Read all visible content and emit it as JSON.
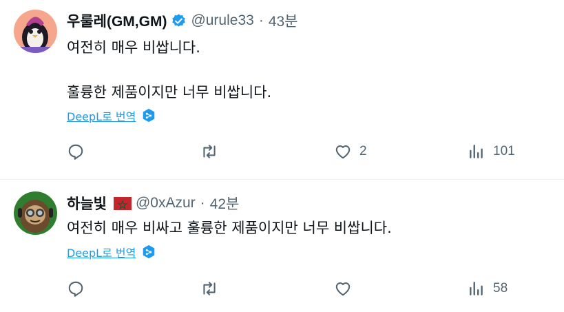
{
  "tweets": [
    {
      "name": "우룰레(GM,GM)",
      "handle": "@urule33",
      "separator": "·",
      "time": "43분",
      "verified": true,
      "lines": [
        "여전히 매우 비쌉니다.",
        "훌륭한 제품이지만 너무 비쌉니다."
      ],
      "translate_label": "DeepL로 번역",
      "reply_count": "",
      "retweet_count": "",
      "like_count": "2",
      "view_count": "101"
    },
    {
      "name": "하늘빛",
      "handle": "@0xAzur",
      "separator": "·",
      "time": "42분",
      "flag": "morocco-flag",
      "lines": [
        "여전히 매우 비싸고 훌륭한 제품이지만 너무 비쌉니다."
      ],
      "translate_label": "DeepL로 번역",
      "reply_count": "",
      "retweet_count": "",
      "like_count": "",
      "view_count": "58"
    }
  ],
  "colors": {
    "text": "#0f1419",
    "secondary": "#536471",
    "link": "#1d9bf0",
    "verified": "#1d9bf0",
    "flag_red": "#c1272d",
    "flag_green": "#006233"
  }
}
